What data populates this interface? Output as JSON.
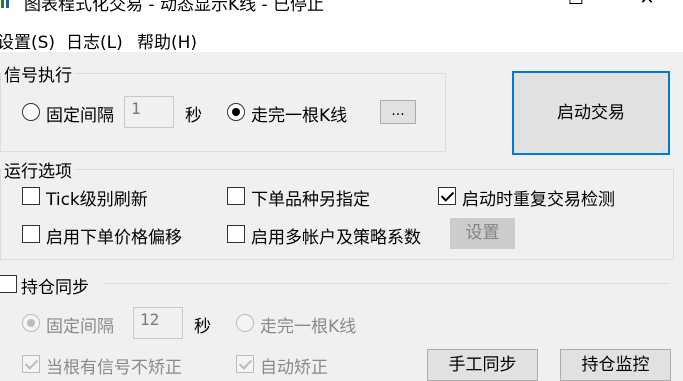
{
  "window": {
    "title": "图表程式化交易 - 动态显示K线 - 已停止",
    "minimize_glyph": "—",
    "maximize_glyph": "☐",
    "close_glyph": "✕"
  },
  "menu": {
    "settings": "设置(S)",
    "log": "日志(L)",
    "help": "帮助(H)"
  },
  "signal_group": {
    "title": "信号执行",
    "fixed_interval_label": "固定间隔",
    "interval_value": "1",
    "seconds_label": "秒",
    "bar_complete_label": "走完一根K线",
    "more_button": "...",
    "fixed_interval_checked": false,
    "bar_complete_checked": true
  },
  "start_button": "启动交易",
  "run_options": {
    "title": "运行选项",
    "tick_refresh": "Tick级别刷新",
    "tick_refresh_checked": false,
    "order_symbol": "下单品种另指定",
    "order_symbol_checked": false,
    "repeat_check": "启动时重复交易检测",
    "repeat_check_checked": true,
    "price_offset": "启用下单价格偏移",
    "price_offset_checked": false,
    "multi_account": "启用多帐户及策略系数",
    "multi_account_checked": false,
    "settings_button": "设置"
  },
  "position_sync": {
    "title": "持仓同步",
    "enabled": false,
    "fixed_interval_label": "固定间隔",
    "interval_value": "12",
    "seconds_label": "秒",
    "bar_complete_label": "走完一根K线",
    "fixed_interval_checked": true,
    "bar_complete_checked": false,
    "no_correct_label": "当根有信号不矫正",
    "no_correct_checked": true,
    "auto_correct_label": "自动矫正",
    "auto_correct_checked": true,
    "manual_sync_button": "手工同步",
    "monitor_button": "持仓监控"
  }
}
